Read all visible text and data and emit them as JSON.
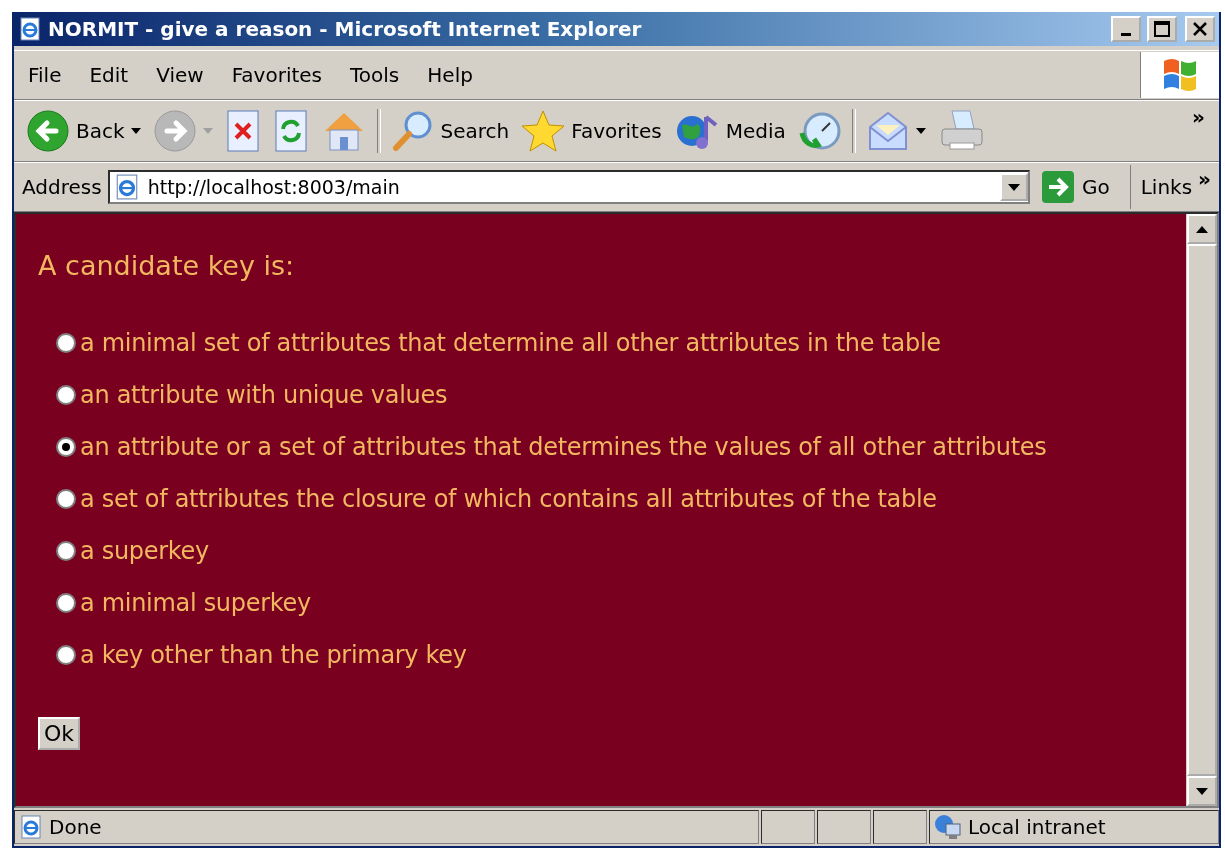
{
  "window": {
    "title": "NORMIT - give a reason - Microsoft Internet Explorer"
  },
  "menu": [
    {
      "label": "File"
    },
    {
      "label": "Edit"
    },
    {
      "label": "View"
    },
    {
      "label": "Favorites"
    },
    {
      "label": "Tools"
    },
    {
      "label": "Help"
    }
  ],
  "toolbar": [
    {
      "kind": "back",
      "label": "Back",
      "disabled": false,
      "dropdown": true
    },
    {
      "kind": "forward",
      "disabled": true,
      "dropdown": true
    },
    {
      "kind": "stop",
      "disabled": false,
      "dropdown": false
    },
    {
      "kind": "refresh",
      "disabled": false,
      "dropdown": false
    },
    {
      "kind": "home",
      "disabled": false,
      "dropdown": false
    },
    {
      "kind": "separator"
    },
    {
      "kind": "search",
      "label": "Search",
      "disabled": false,
      "dropdown": false
    },
    {
      "kind": "favorites",
      "label": "Favorites",
      "disabled": false,
      "dropdown": false
    },
    {
      "kind": "media",
      "label": "Media",
      "disabled": false,
      "dropdown": false
    },
    {
      "kind": "history",
      "disabled": false,
      "dropdown": false
    },
    {
      "kind": "separator"
    },
    {
      "kind": "mail",
      "disabled": false,
      "dropdown": true
    },
    {
      "kind": "print",
      "disabled": false,
      "dropdown": false
    }
  ],
  "toolbar_more": "»",
  "address": {
    "label": "Address",
    "value": "http://localhost:8003/main",
    "go": "Go",
    "links": "Links",
    "links_more": "»"
  },
  "page": {
    "question": "A candidate key is:",
    "options": [
      {
        "label": "a minimal set of attributes that determine all other attributes in the table",
        "selected": false
      },
      {
        "label": "an attribute with unique values",
        "selected": false
      },
      {
        "label": "an attribute or a set of attributes that determines the values of all other attributes",
        "selected": true
      },
      {
        "label": "a set of attributes the closure of which contains all attributes of the table",
        "selected": false
      },
      {
        "label": "a superkey",
        "selected": false
      },
      {
        "label": "a minimal superkey",
        "selected": false
      },
      {
        "label": "a key other than the primary key",
        "selected": false
      }
    ],
    "button": "Ok"
  },
  "status_bar": {
    "text": "Done",
    "zone": "Local intranet"
  }
}
